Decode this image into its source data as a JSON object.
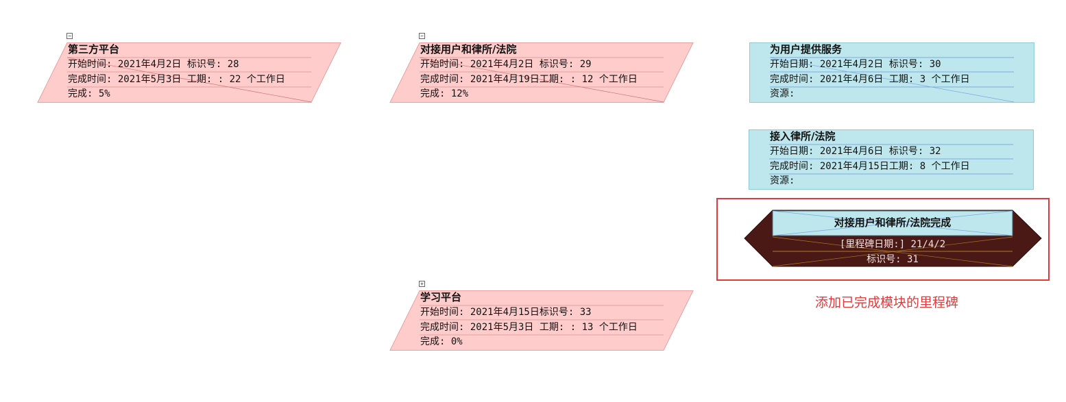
{
  "colors": {
    "summary_fill": "#ffcccc",
    "summary_border": "#e8a0a0",
    "task_fill": "#bde7ec",
    "task_border": "#8ccbd4",
    "milestone_fill": "#4a1915",
    "milestone_title_fill": "#bde7ec",
    "annotation": "#e23a3a"
  },
  "summary_tasks": [
    {
      "toggle": "−",
      "title": "第三方平台",
      "row1": "开始时间: 2021年4月2日 标识号:  28",
      "row2": "完成时间: 2021年5月3日 工期:   : 22 个工作日",
      "row3": "完成: 5%"
    },
    {
      "toggle": "−",
      "title": "对接用户和律所/法院",
      "row1": "开始时间: 2021年4月2日 标识号:  29",
      "row2": "完成时间: 2021年4月19日工期:   : 12 个工作日",
      "row3": "完成: 12%"
    },
    {
      "toggle": "+",
      "title": "学习平台",
      "row1": "开始时间: 2021年4月15日标识号:  33",
      "row2": "完成时间: 2021年5月3日 工期:   : 13 个工作日",
      "row3": "完成: 0%"
    }
  ],
  "tasks": [
    {
      "title": "为用户提供服务",
      "row1": "开始日期: 2021年4月2日 标识号:  30",
      "row2": "完成时间: 2021年4月6日 工期:    3 个工作日",
      "row3": "资源:"
    },
    {
      "title": "接入律所/法院",
      "row1": "开始日期: 2021年4月6日 标识号:  32",
      "row2": "完成时间: 2021年4月15日工期:    8 个工作日",
      "row3": "资源:"
    }
  ],
  "milestone": {
    "title": "对接用户和律所/法院完成",
    "date_line": "[里程碑日期:] 21/4/2",
    "id_line": "标识号: 31"
  },
  "annotation": "添加已完成模块的里程碑"
}
